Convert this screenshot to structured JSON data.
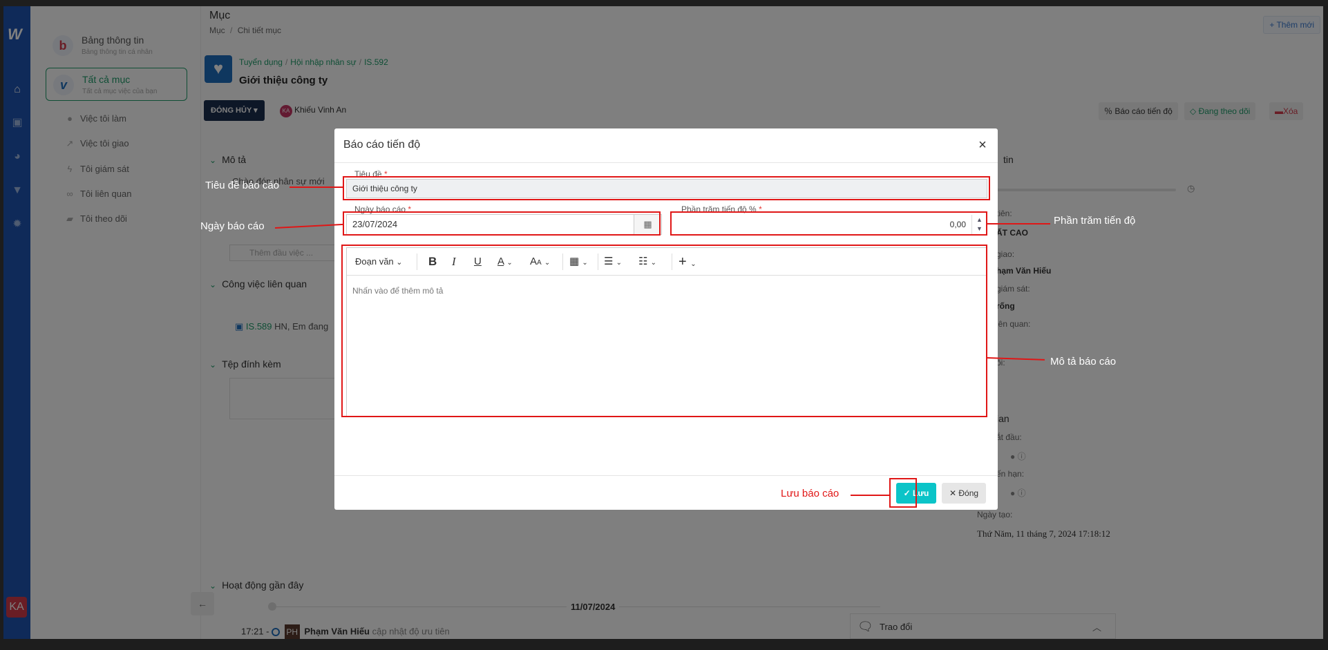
{
  "rail": {
    "logo": "W",
    "icons": [
      "home-icon",
      "briefcase-icon",
      "pie-chart-icon",
      "filter-icon",
      "gear-icon"
    ],
    "avatar": "KA"
  },
  "sidebar": {
    "dashboard": {
      "letter": "b",
      "title": "Bảng thông tin",
      "subtitle": "Bảng thông tin cá nhân"
    },
    "all_items": {
      "letter": "v",
      "title": "Tất cả mục",
      "subtitle": "Tất cả mục việc của bạn"
    },
    "items": [
      {
        "label": "Việc tôi làm"
      },
      {
        "label": "Việc tôi giao"
      },
      {
        "label": "Tôi giám sát"
      },
      {
        "label": "Tôi liên quan"
      },
      {
        "label": "Tôi theo dõi"
      }
    ]
  },
  "page": {
    "title": "Mục",
    "breadcrumb": [
      "Mục",
      "Chi tiết mục"
    ],
    "add_new": "+ Thêm mới"
  },
  "item": {
    "breadcrumb": [
      "Tuyển dụng",
      "Hội nhập nhân sự",
      "IS.592"
    ],
    "title": "Giới thiệu công ty",
    "status": "ĐÓNG HỦY",
    "assignee_initials": "KA",
    "assignee": "Khiếu Vinh An",
    "actions": [
      "Báo cáo tiến độ",
      "Đang theo dõi",
      "Xóa"
    ]
  },
  "sections": {
    "description": "Mô tả",
    "description_text": "Chào đón nhân sự mới",
    "add_subtask_placeholder": "Thêm đầu việc ...",
    "related": "Công việc liên quan",
    "related_item_code": "IS.589",
    "related_item_text": "HN, Em đang",
    "attachments": "Tệp đính kèm",
    "activity": "Hoạt động gần đây"
  },
  "right_panel": {
    "header": "tin",
    "priority_label": "tiên:",
    "priority_value": "ẤT CAO",
    "assigner_label": "giao:",
    "assigner_value": "hạm Văn Hiếu",
    "supervisor_label": "giám sát:",
    "supervisor_value": "rống",
    "related_label": "iên quan:",
    "follow_label": "õi:",
    "time_header": "ian",
    "start_label": "ắt đầu:",
    "deadline_label": "ến hạn:",
    "created_label": "Ngày tạo:",
    "created_value": "Thứ Năm, 11 tháng 7, 2024 17:18:12"
  },
  "timeline": {
    "date": "11/07/2024",
    "time": "17:21 -",
    "avatar": "PH",
    "user": "Phạm Văn Hiếu",
    "action": "cập nhật độ ưu tiên"
  },
  "chat": {
    "label": "Trao đổi"
  },
  "modal": {
    "title": "Báo cáo tiến độ",
    "title_label": "Tiêu đề",
    "title_value": "Giới thiệu công ty",
    "date_label": "Ngày báo cáo",
    "date_value": "23/07/2024",
    "percent_label": "Phần trăm tiến độ %",
    "percent_value": "0,00",
    "editor_style": "Đoạn văn",
    "editor_placeholder": "Nhấn vào để thêm mô tả",
    "save": "Lưu",
    "close": "Đóng"
  },
  "annotations": {
    "title": "Tiêu đề báo cáo",
    "date": "Ngày báo cáo",
    "percent": "Phần trăm tiến độ",
    "description": "Mô tả báo cáo",
    "save": "Lưu báo cáo",
    "color": "#e01616"
  }
}
